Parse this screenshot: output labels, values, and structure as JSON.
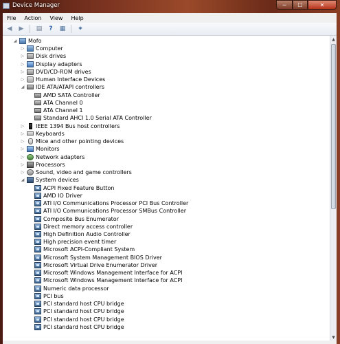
{
  "window": {
    "title": "Device Manager",
    "minimize_glyph": "─",
    "maximize_glyph": "☐",
    "close_glyph": "✕"
  },
  "menu": [
    "File",
    "Action",
    "View",
    "Help"
  ],
  "toolbar": [
    {
      "icon": "back-arrow-icon",
      "glyph": "◀",
      "color": "#7a8da6"
    },
    {
      "icon": "forward-arrow-icon",
      "glyph": "▶",
      "color": "#7a8da6"
    },
    {
      "icon": "console-tree-icon",
      "glyph": "▤",
      "color": "#6b7c92"
    },
    {
      "icon": "help-icon",
      "glyph": "?",
      "color": "#2f64b0"
    },
    {
      "icon": "properties-icon",
      "glyph": "▦",
      "color": "#4a6f9c"
    },
    {
      "icon": "scan-hardware-icon",
      "glyph": "⌖",
      "color": "#4a6f9c"
    }
  ],
  "tree": [
    {
      "label": "Mofo",
      "level": 0,
      "expander": "◢",
      "icon": "computer"
    },
    {
      "label": "Computer",
      "level": 1,
      "expander": "▷",
      "icon": "computer"
    },
    {
      "label": "Disk drives",
      "level": 1,
      "expander": "▷",
      "icon": "disk"
    },
    {
      "label": "Display adapters",
      "level": 1,
      "expander": "▷",
      "icon": "monitor"
    },
    {
      "label": "DVD/CD-ROM drives",
      "level": 1,
      "expander": "▷",
      "icon": "disk"
    },
    {
      "label": "Human Interface Devices",
      "level": 1,
      "expander": "▷",
      "icon": "hid"
    },
    {
      "label": "IDE ATA/ATAPI controllers",
      "level": 1,
      "expander": "◢",
      "icon": "ide"
    },
    {
      "label": "AMD SATA Controller",
      "level": 2,
      "expander": "",
      "icon": "ide"
    },
    {
      "label": "ATA Channel 0",
      "level": 2,
      "expander": "",
      "icon": "ide"
    },
    {
      "label": "ATA Channel 1",
      "level": 2,
      "expander": "",
      "icon": "ide"
    },
    {
      "label": "Standard AHCI 1.0 Serial ATA Controller",
      "level": 2,
      "expander": "",
      "icon": "ide"
    },
    {
      "label": "IEEE 1394 Bus host controllers",
      "level": 1,
      "expander": "▷",
      "icon": "usb"
    },
    {
      "label": "Keyboards",
      "level": 1,
      "expander": "▷",
      "icon": "kbd"
    },
    {
      "label": "Mice and other pointing devices",
      "level": 1,
      "expander": "▷",
      "icon": "mouse"
    },
    {
      "label": "Monitors",
      "level": 1,
      "expander": "▷",
      "icon": "monitor"
    },
    {
      "label": "Network adapters",
      "level": 1,
      "expander": "▷",
      "icon": "net"
    },
    {
      "label": "Processors",
      "level": 1,
      "expander": "▷",
      "icon": "cpu"
    },
    {
      "label": "Sound, video and game controllers",
      "level": 1,
      "expander": "▷",
      "icon": "sound"
    },
    {
      "label": "System devices",
      "level": 1,
      "expander": "◢",
      "icon": "chip"
    },
    {
      "label": "ACPI Fixed Feature Button",
      "level": 2,
      "expander": "",
      "icon": "dev"
    },
    {
      "label": "AMD IO Driver",
      "level": 2,
      "expander": "",
      "icon": "dev"
    },
    {
      "label": "ATI I/O Communications Processor PCI Bus Controller",
      "level": 2,
      "expander": "",
      "icon": "dev"
    },
    {
      "label": "ATI I/O Communications Processor SMBus Controller",
      "level": 2,
      "expander": "",
      "icon": "dev"
    },
    {
      "label": "Composite Bus Enumerator",
      "level": 2,
      "expander": "",
      "icon": "dev"
    },
    {
      "label": "Direct memory access controller",
      "level": 2,
      "expander": "",
      "icon": "dev"
    },
    {
      "label": "High Definition Audio Controller",
      "level": 2,
      "expander": "",
      "icon": "dev"
    },
    {
      "label": "High precision event timer",
      "level": 2,
      "expander": "",
      "icon": "dev"
    },
    {
      "label": "Microsoft ACPI-Compliant System",
      "level": 2,
      "expander": "",
      "icon": "dev"
    },
    {
      "label": "Microsoft System Management BIOS Driver",
      "level": 2,
      "expander": "",
      "icon": "dev"
    },
    {
      "label": "Microsoft Virtual Drive Enumerator Driver",
      "level": 2,
      "expander": "",
      "icon": "dev"
    },
    {
      "label": "Microsoft Windows Management Interface for ACPI",
      "level": 2,
      "expander": "",
      "icon": "dev"
    },
    {
      "label": "Microsoft Windows Management Interface for ACPI",
      "level": 2,
      "expander": "",
      "icon": "dev"
    },
    {
      "label": "Numeric data processor",
      "level": 2,
      "expander": "",
      "icon": "dev"
    },
    {
      "label": "PCI bus",
      "level": 2,
      "expander": "",
      "icon": "dev"
    },
    {
      "label": "PCI standard host CPU bridge",
      "level": 2,
      "expander": "",
      "icon": "dev"
    },
    {
      "label": "PCI standard host CPU bridge",
      "level": 2,
      "expander": "",
      "icon": "dev"
    },
    {
      "label": "PCI standard host CPU bridge",
      "level": 2,
      "expander": "",
      "icon": "dev"
    },
    {
      "label": "PCI standard host CPU bridge",
      "level": 2,
      "expander": "",
      "icon": "dev"
    }
  ],
  "scrollbar": {
    "up_glyph": "▲",
    "down_glyph": "▼"
  }
}
